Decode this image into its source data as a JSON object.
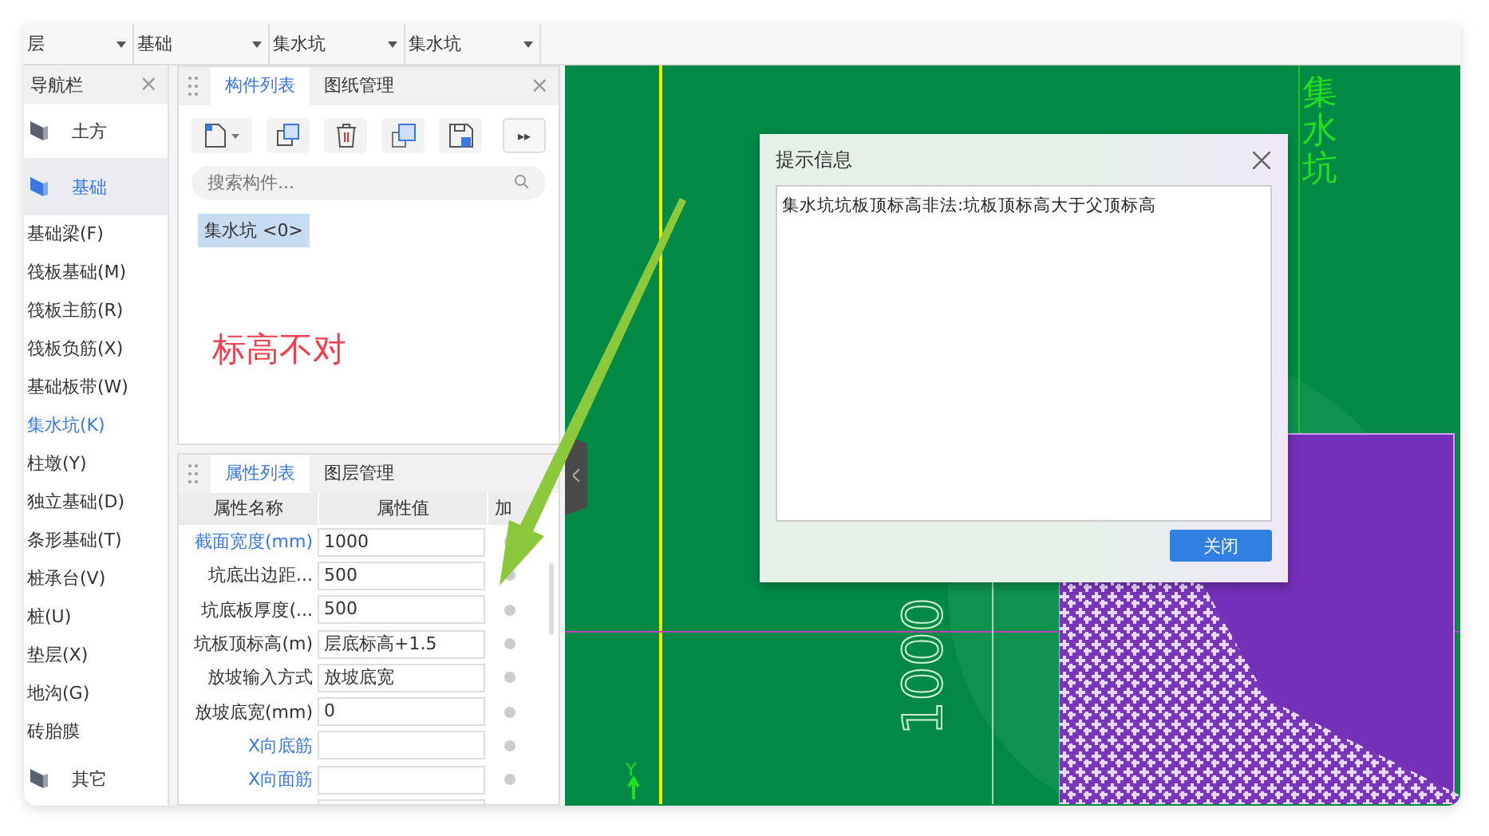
{
  "toolbar": {
    "dropdowns": [
      {
        "value": "层"
      },
      {
        "value": "基础"
      },
      {
        "value": "集水坑"
      },
      {
        "value": "集水坑"
      }
    ]
  },
  "nav": {
    "title": "导航栏",
    "close": "×",
    "items": [
      {
        "kind": "group",
        "label": "土方",
        "selected": false
      },
      {
        "kind": "group",
        "label": "基础",
        "selected": true
      },
      {
        "kind": "item",
        "label": "基础梁(F)",
        "selected": false
      },
      {
        "kind": "item",
        "label": "筏板基础(M)",
        "selected": false
      },
      {
        "kind": "item",
        "label": "筏板主筋(R)",
        "selected": false
      },
      {
        "kind": "item",
        "label": "筏板负筋(X)",
        "selected": false
      },
      {
        "kind": "item",
        "label": "基础板带(W)",
        "selected": false
      },
      {
        "kind": "item",
        "label": "集水坑(K)",
        "selected": true
      },
      {
        "kind": "item",
        "label": "柱墩(Y)",
        "selected": false
      },
      {
        "kind": "item",
        "label": "独立基础(D)",
        "selected": false
      },
      {
        "kind": "item",
        "label": "条形基础(T)",
        "selected": false
      },
      {
        "kind": "item",
        "label": "桩承台(V)",
        "selected": false
      },
      {
        "kind": "item",
        "label": "桩(U)",
        "selected": false
      },
      {
        "kind": "item",
        "label": "垫层(X)",
        "selected": false
      },
      {
        "kind": "item",
        "label": "地沟(G)",
        "selected": false
      },
      {
        "kind": "item",
        "label": "砖胎膜",
        "selected": false
      },
      {
        "kind": "group",
        "label": "其它",
        "selected": false
      }
    ]
  },
  "component_panel": {
    "tabs": [
      {
        "label": "构件列表",
        "selected": true
      },
      {
        "label": "图纸管理",
        "selected": false
      }
    ],
    "close": "×",
    "more": "▸▸",
    "search": {
      "placeholder": "搜索构件..."
    },
    "components": [
      {
        "label": "集水坑 <0>",
        "selected": true
      }
    ],
    "annotation": "标高不对"
  },
  "property_panel": {
    "tabs": [
      {
        "label": "属性列表",
        "selected": true
      },
      {
        "label": "图层管理",
        "selected": false
      }
    ],
    "columns": [
      "属性名称",
      "属性值",
      "加"
    ],
    "rows": [
      {
        "name": "截面宽度(mm)",
        "value": "1000",
        "highlighted": true
      },
      {
        "name": "坑底出边距...",
        "value": "500",
        "highlighted": false
      },
      {
        "name": "坑底板厚度(...",
        "value": "500",
        "highlighted": false
      },
      {
        "name": "坑板顶标高(m)",
        "value": "层底标高+1.5",
        "highlighted": false
      },
      {
        "name": "放坡输入方式",
        "value": "放坡底宽",
        "highlighted": false
      },
      {
        "name": "放坡底宽(mm)",
        "value": "0",
        "highlighted": false
      },
      {
        "name": "X向底筋",
        "value": "",
        "highlighted": true
      },
      {
        "name": "X向面筋",
        "value": "",
        "highlighted": true
      }
    ]
  },
  "canvas": {
    "label": "集水坑",
    "dimension": "1000",
    "axis": "Y"
  },
  "dialog": {
    "title": "提示信息",
    "message": "集水坑坑板顶标高非法:坑板顶标高大于父顶标高",
    "button": "关闭"
  }
}
